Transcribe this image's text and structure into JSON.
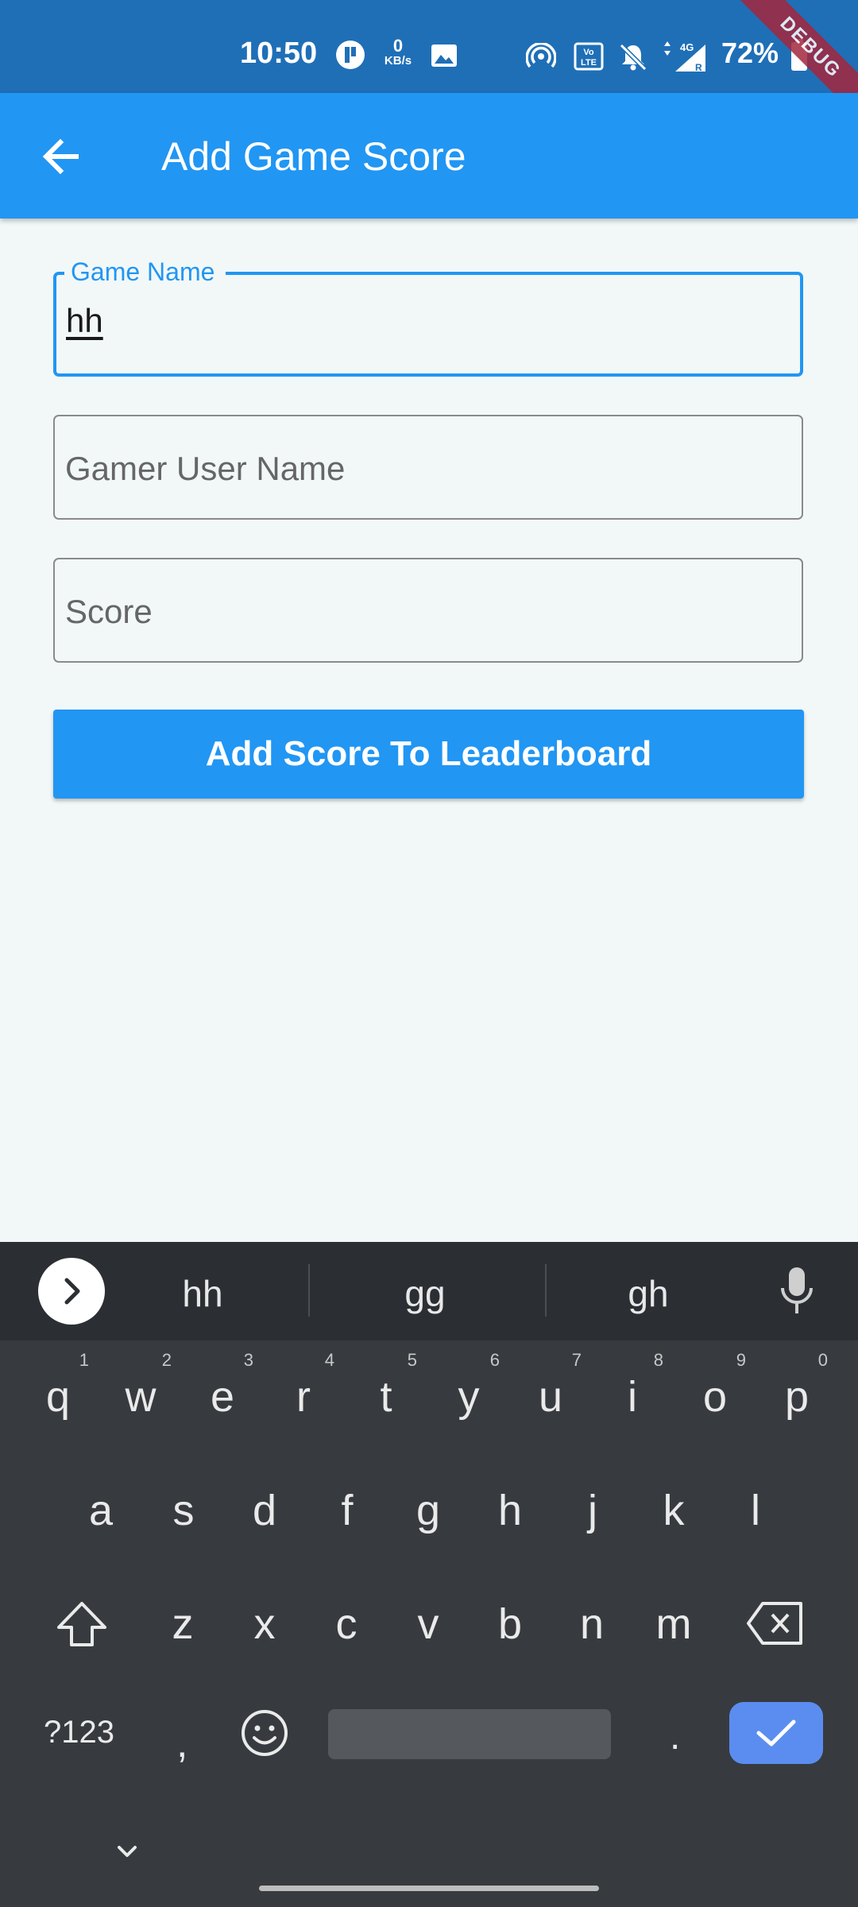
{
  "status_bar": {
    "time": "10:50",
    "net_speed_value": "0",
    "net_speed_unit": "KB/s",
    "battery_percent": "72%",
    "debug_banner": "DEBUG"
  },
  "app_bar": {
    "title": "Add Game Score"
  },
  "form": {
    "game_name": {
      "label": "Game Name",
      "value": "hh"
    },
    "gamer_user_name": {
      "placeholder": "Gamer User Name"
    },
    "score": {
      "placeholder": "Score"
    },
    "submit_label": "Add Score To Leaderboard"
  },
  "keyboard": {
    "suggestions": [
      "hh",
      "gg",
      "gh"
    ],
    "row1": [
      {
        "k": "q",
        "n": "1"
      },
      {
        "k": "w",
        "n": "2"
      },
      {
        "k": "e",
        "n": "3"
      },
      {
        "k": "r",
        "n": "4"
      },
      {
        "k": "t",
        "n": "5"
      },
      {
        "k": "y",
        "n": "6"
      },
      {
        "k": "u",
        "n": "7"
      },
      {
        "k": "i",
        "n": "8"
      },
      {
        "k": "o",
        "n": "9"
      },
      {
        "k": "p",
        "n": "0"
      }
    ],
    "row2": [
      "a",
      "s",
      "d",
      "f",
      "g",
      "h",
      "j",
      "k",
      "l"
    ],
    "row3": [
      "z",
      "x",
      "c",
      "v",
      "b",
      "n",
      "m"
    ],
    "symbols_label": "?123",
    "comma": ",",
    "period": "."
  }
}
